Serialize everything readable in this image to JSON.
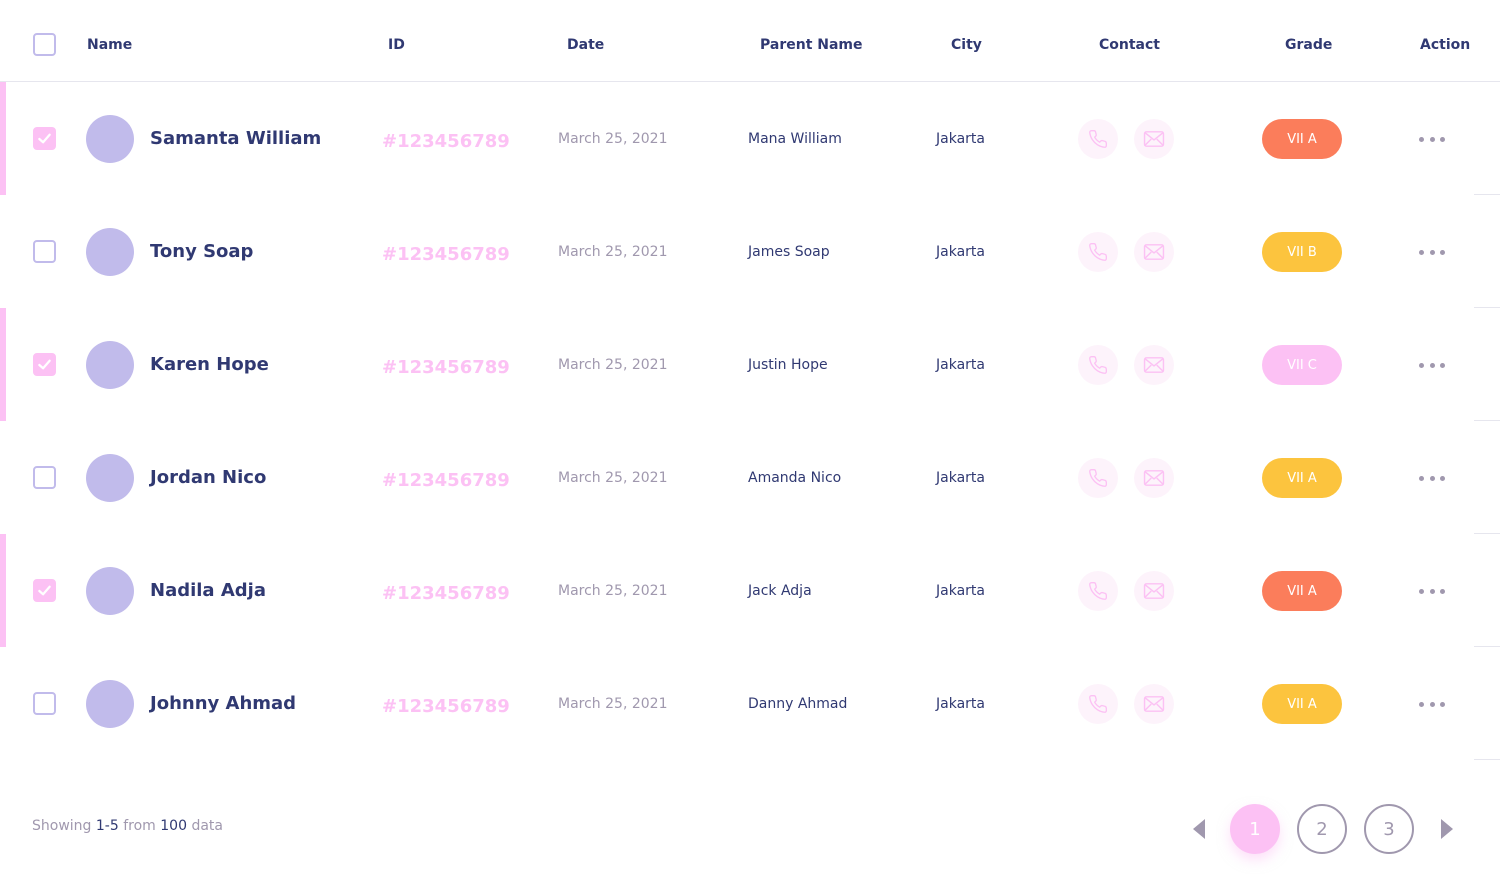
{
  "table": {
    "headers": {
      "name": "Name",
      "id": "ID",
      "date": "Date",
      "parent": "Parent Name",
      "city": "City",
      "contact": "Contact",
      "grade": "Grade",
      "action": "Action"
    },
    "rows": [
      {
        "selected": true,
        "name": "Samanta William",
        "id": "#123456789",
        "date": "March 25, 2021",
        "parent": "Mana William",
        "city": "Jakarta",
        "grade": "VII A",
        "grade_color": "#fb7d5b"
      },
      {
        "selected": false,
        "name": "Tony Soap",
        "id": "#123456789",
        "date": "March 25, 2021",
        "parent": "James Soap",
        "city": "Jakarta",
        "grade": "VII B",
        "grade_color": "#fcc43e"
      },
      {
        "selected": true,
        "name": "Karen Hope",
        "id": "#123456789",
        "date": "March 25, 2021",
        "parent": "Justin Hope",
        "city": "Jakarta",
        "grade": "VII C",
        "grade_color": "#fcc1f4"
      },
      {
        "selected": false,
        "name": "Jordan Nico",
        "id": "#123456789",
        "date": "March 25, 2021",
        "parent": "Amanda Nico",
        "city": "Jakarta",
        "grade": "VII A",
        "grade_color": "#fcc43e"
      },
      {
        "selected": true,
        "name": "Nadila Adja",
        "id": "#123456789",
        "date": "March 25, 2021",
        "parent": "Jack Adja",
        "city": "Jakarta",
        "grade": "VII A",
        "grade_color": "#fb7d5b"
      },
      {
        "selected": false,
        "name": "Johnny Ahmad",
        "id": "#123456789",
        "date": "March 25, 2021",
        "parent": "Danny Ahmad",
        "city": "Jakarta",
        "grade": "VII A",
        "grade_color": "#fcc43e"
      }
    ]
  },
  "footer": {
    "showing_prefix": "Showing",
    "range": "1-5",
    "from_word": "from",
    "total": "100",
    "suffix": "data"
  },
  "pagination": {
    "pages": [
      "1",
      "2",
      "3"
    ],
    "active_page": "1"
  },
  "icons": {
    "contact_phone": "phone-icon",
    "contact_email": "mail-icon",
    "action": "more-horizontal-icon",
    "prev": "triangle-left-icon",
    "next": "triangle-right-icon",
    "check": "check-icon"
  },
  "colors": {
    "primary_text": "#303972",
    "muted_text": "#a098ae",
    "accent_pink": "#fcc1f4",
    "avatar_purple": "#c1bbeb",
    "grade_orange": "#fb7d5b",
    "grade_yellow": "#fcc43e"
  }
}
